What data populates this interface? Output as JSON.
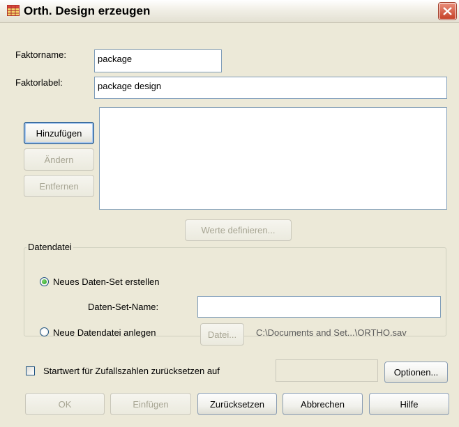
{
  "window": {
    "title": "Orth. Design erzeugen",
    "app_icon": "spss-table-icon",
    "close_icon": "close-icon"
  },
  "form": {
    "factor_name_label": "Faktorname:",
    "factor_name_value": "package",
    "factor_label_label": "Faktorlabel:",
    "factor_label_value": "package design"
  },
  "factor_buttons": {
    "add": "Hinzufügen",
    "change": "Ändern",
    "remove": "Entfernen"
  },
  "define_values_button": "Werte definieren...",
  "datafile": {
    "group_label": "Datendatei",
    "new_dataset_label": "Neues Daten-Set erstellen",
    "dataset_name_label": "Daten-Set-Name:",
    "dataset_name_value": "",
    "new_datafile_label": "Neue Datendatei anlegen",
    "file_button": "Datei...",
    "file_path": "C:\\Documents and Set...\\ORTHO.sav",
    "selected_option": "new_dataset"
  },
  "random_seed": {
    "label": "Startwert für Zufallszahlen zurücksetzen auf",
    "checked": false,
    "value": ""
  },
  "options_button": "Optionen...",
  "bottom_buttons": {
    "ok": "OK",
    "paste": "Einfügen",
    "reset": "Zurücksetzen",
    "cancel": "Abbrechen",
    "help": "Hilfe"
  },
  "colors": {
    "dialog_bg": "#ece9d8",
    "input_border": "#7f9db9",
    "close_button": "#c6432a",
    "radio_selected": "#21a121"
  }
}
